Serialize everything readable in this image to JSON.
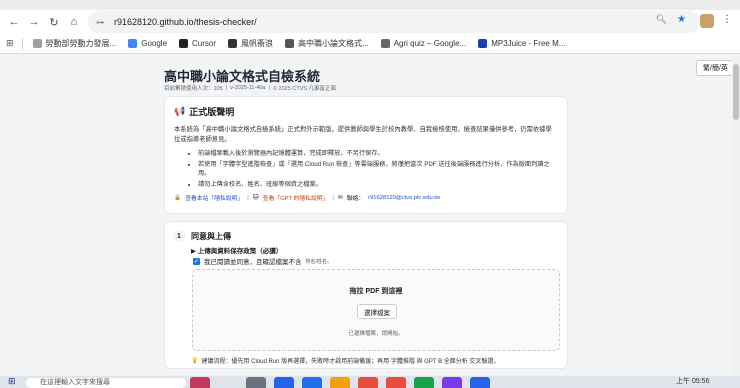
{
  "browser": {
    "url": "r91628120.github.io/thesis-checker/",
    "bookmarks": [
      {
        "label": "勞動部勞動力發展...",
        "color": "#9aa0a6"
      },
      {
        "label": "Google",
        "color": "#4285f4"
      },
      {
        "label": "Cursor",
        "color": "#222222"
      },
      {
        "label": "風帆衝浪",
        "color": "#333333"
      },
      {
        "label": "高中職小論文格式...",
        "color": "#555555"
      },
      {
        "label": "Agri quiz – Google...",
        "color": "#666666"
      },
      {
        "label": "MP3Juice - Free M...",
        "color": "#1a3fa8"
      }
    ]
  },
  "page": {
    "language_button": "繁/簡/英",
    "title": "高中職小論文格式自檢系統",
    "meta": {
      "visitors": "目前累積使用人次：105",
      "version": "v-2025-11-40a",
      "copyright": "© 2025 CTVS 凡事皆正面"
    },
    "notice": {
      "icon": "megaphone-icon",
      "heading": "正式版聲明",
      "intro": "本系統為「高中職小論文格式自檢系統」正式對外示範版，提供教師與學生於校內教學、自我檢核使用，檢查結果僅供參考，仍需依據學位或指導老師意見。",
      "bullets": [
        "前端檔案載入後於瀏覽器內記憶體運算，完成即釋放，不另行保存。",
        "若使用「字體字型進階檢查」或「選用 Cloud Run 檢查」等雲端服務，將僅把當次 PDF 送往後端服務進行分析，作為版面判讀之用。",
        "請勿上傳含校名、姓名、班級等個資之檔案。"
      ],
      "links": {
        "privacy": "查看本站「隱私說明」",
        "gpt_privacy": "查看「GPT 的隱私說明」",
        "contact_label": "聯絡：",
        "contact_email": "r91628120@ctvs.ptc.edu.tw"
      }
    },
    "step1": {
      "number": "1",
      "title": "同意與上傳",
      "policy_toggle": "▶ 上傳與資料保存政策（必讀）",
      "agree_text": "我已閱讀並同意，且確認檔案不含",
      "agree_note": "校名/姓名。",
      "agree_checked": true,
      "drop_title": "拖拉 PDF 到這裡",
      "pick_button": "選擇檔案",
      "no_file": "已選擇檔案，請開始。",
      "tip": "建議流程：優先用 Cloud Run 版再選擇，失敗時才啟用前端備援；再用 字體推階 與 GPT B 全面分析 交叉驗證。"
    }
  },
  "taskbar": {
    "search_placeholder": "在這裡輸入文字來搜尋",
    "time": "上午 05:56",
    "app_colors": [
      "#c23b5f",
      "#e0e4ea",
      "#6b7280",
      "#2563eb",
      "#1f6feb",
      "#f59e0b",
      "#e74c3c",
      "#e74c3c",
      "#16a34a",
      "#7c3aed",
      "#2563eb"
    ]
  }
}
